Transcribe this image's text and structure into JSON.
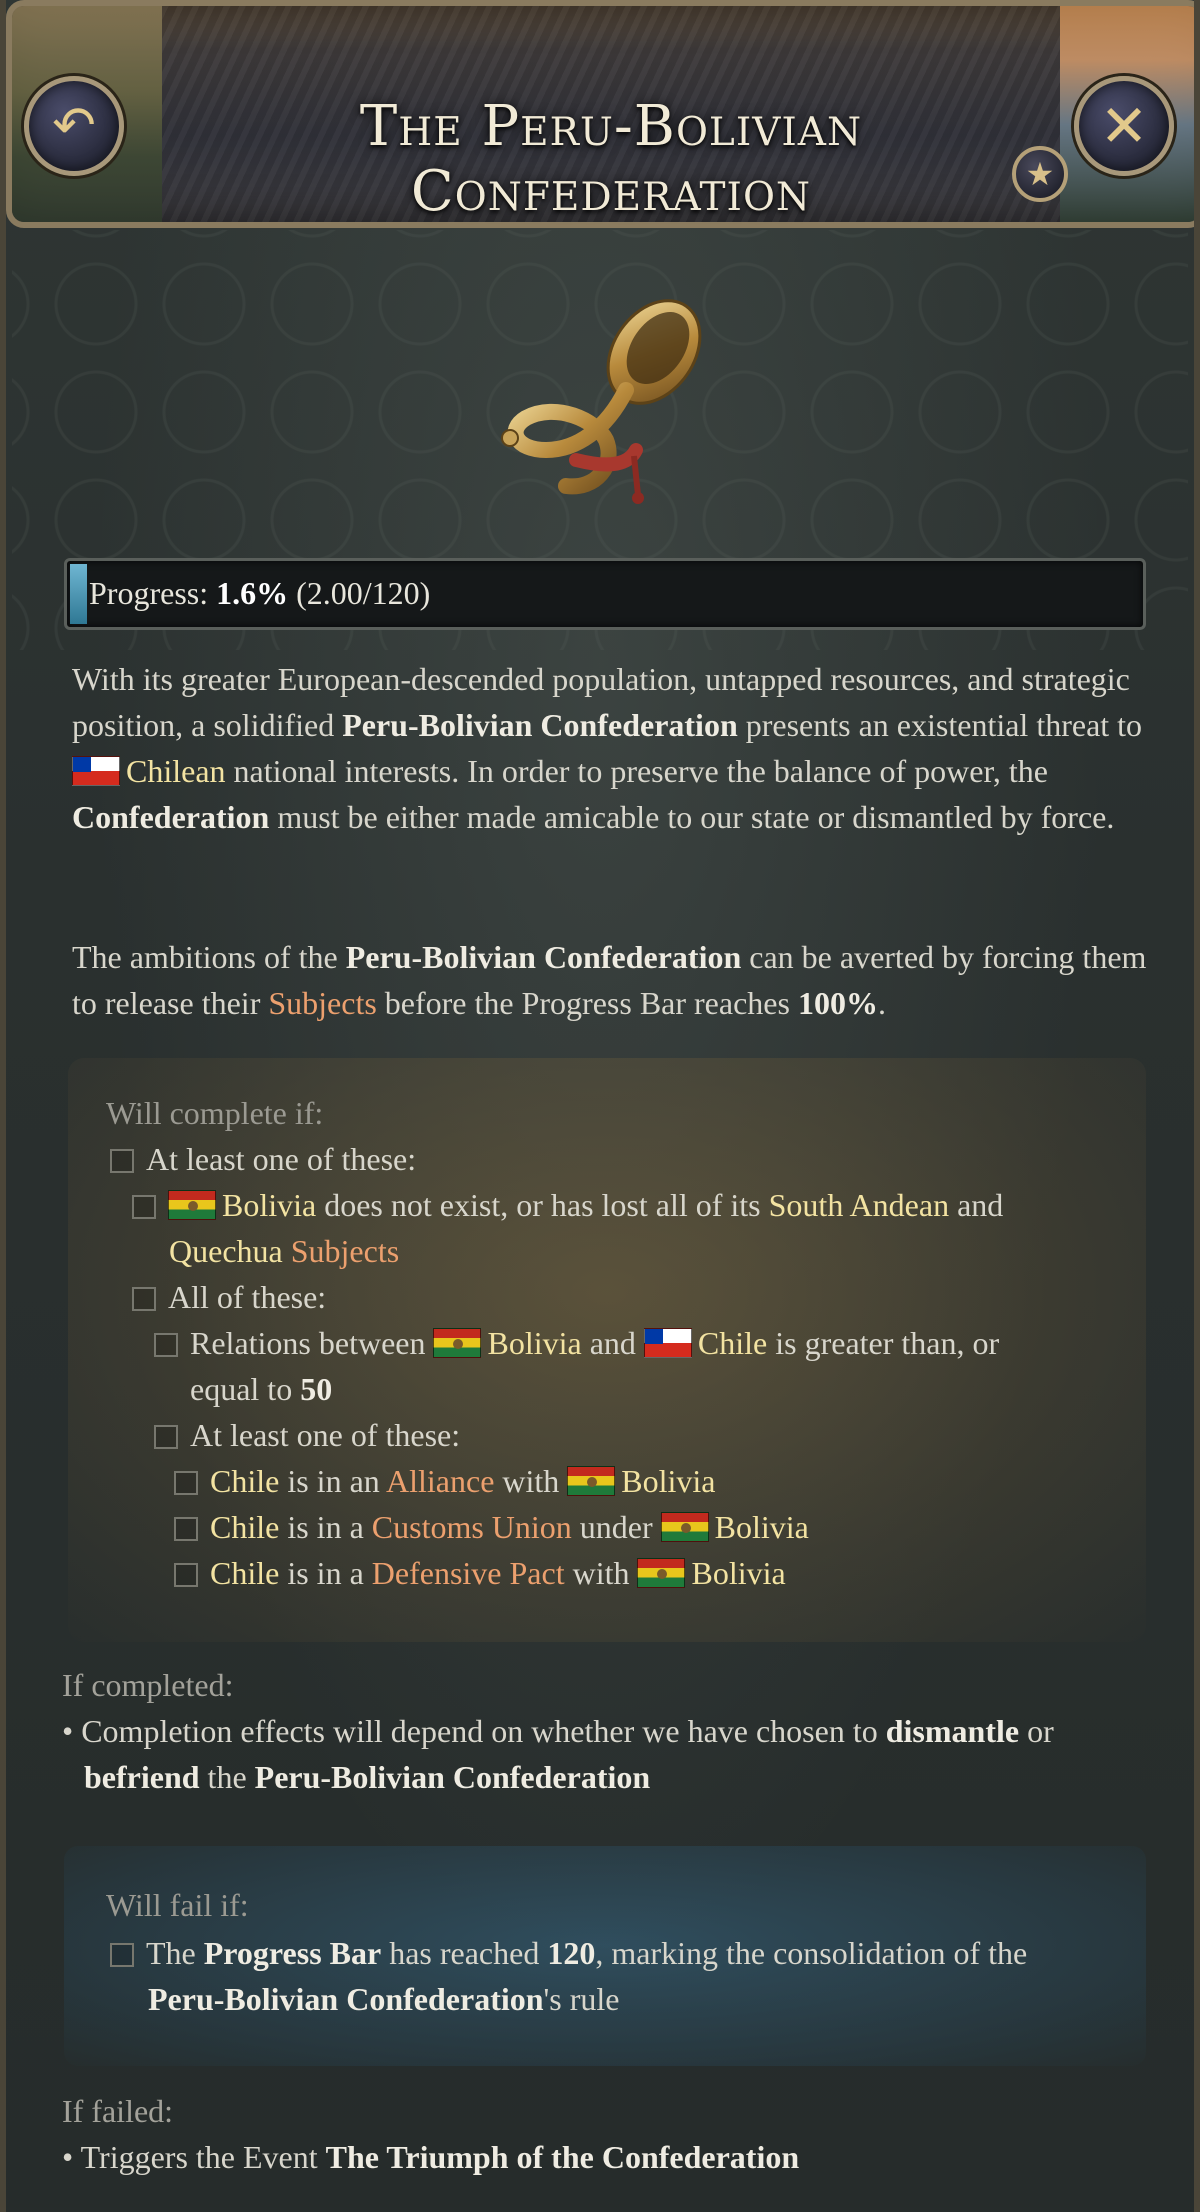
{
  "header": {
    "title": "The Peru-Bolivian Confederation",
    "back_icon": "↶",
    "close_icon": "✕",
    "star_icon": "★"
  },
  "progress": {
    "label": "Progress: ",
    "percent": "1.6%",
    "detail": "(2.00/120)",
    "fraction": 0.016
  },
  "description": {
    "p1_a": "With its greater European-descended population, untapped resources, and strategic position, a solidified ",
    "p1_b": "Peru-Bolivian Confederation",
    "p1_c": " presents an existential threat to ",
    "p1_d": "Chilean",
    "p1_e": " national interests. In order to preserve the balance of power, the ",
    "p1_f": "Confederation",
    "p1_g": " must be either made amicable to our state or dismantled by force.",
    "p2_a": "The ambitions of the ",
    "p2_b": "Peru-Bolivian Confederation",
    "p2_c": " can be averted by forcing them to release their ",
    "p2_d": "Subjects",
    "p2_e": " before the Progress Bar reaches ",
    "p2_f": "100%",
    "p2_g": "."
  },
  "complete": {
    "heading": "Will complete if:",
    "l1": "At least one of these:",
    "l2_country": "Bolivia",
    "l2_mid": " does not exist, or has lost all of its ",
    "l2_region": "South Andean",
    "l2_and": " and",
    "l3_region": "Quechua",
    "l3_subjects": "Subjects",
    "l4": "All of these:",
    "l5_a": "Relations between ",
    "l5_country1": "Bolivia",
    "l5_and": " and ",
    "l5_country2": "Chile",
    "l5_rest": " is greater than, or",
    "l6_a": "equal to ",
    "l6_val": "50",
    "l7": "At least one of these:",
    "l8_chile": "Chile",
    "l8_a": " is in an ",
    "l8_kw": "Alliance",
    "l8_b": " with ",
    "l8_country": "Bolivia",
    "l9_chile": "Chile",
    "l9_a": " is in a ",
    "l9_kw": "Customs Union",
    "l9_b": " under ",
    "l9_country": "Bolivia",
    "l10_chile": "Chile",
    "l10_a": " is in a ",
    "l10_kw": "Defensive Pact",
    "l10_b": " with ",
    "l10_country": "Bolivia"
  },
  "if_completed": {
    "heading": "If completed:",
    "bullet": "•",
    "a": "Completion effects will depend on whether we have chosen to ",
    "b": "dismantle",
    "c": " or",
    "d": "befriend",
    "e": " the ",
    "f": "Peru-Bolivian Confederation"
  },
  "fail": {
    "heading": "Will fail if:",
    "a": "The ",
    "b": "Progress Bar",
    "c": " has reached ",
    "d": "120",
    "e": ", marking the consolidation of the",
    "f": "Peru-Bolivian Confederation",
    "g": "'s rule"
  },
  "if_failed": {
    "heading": "If failed:",
    "bullet": "•",
    "a": "Triggers the Event ",
    "b": "The Triumph of the Confederation"
  },
  "colors": {
    "accent_gold": "#f3e3a2",
    "accent_orange": "#eca06e",
    "progress_fill": "#4a9bbb",
    "complete_tint": "#8c703e",
    "fail_tint": "#345f78"
  }
}
